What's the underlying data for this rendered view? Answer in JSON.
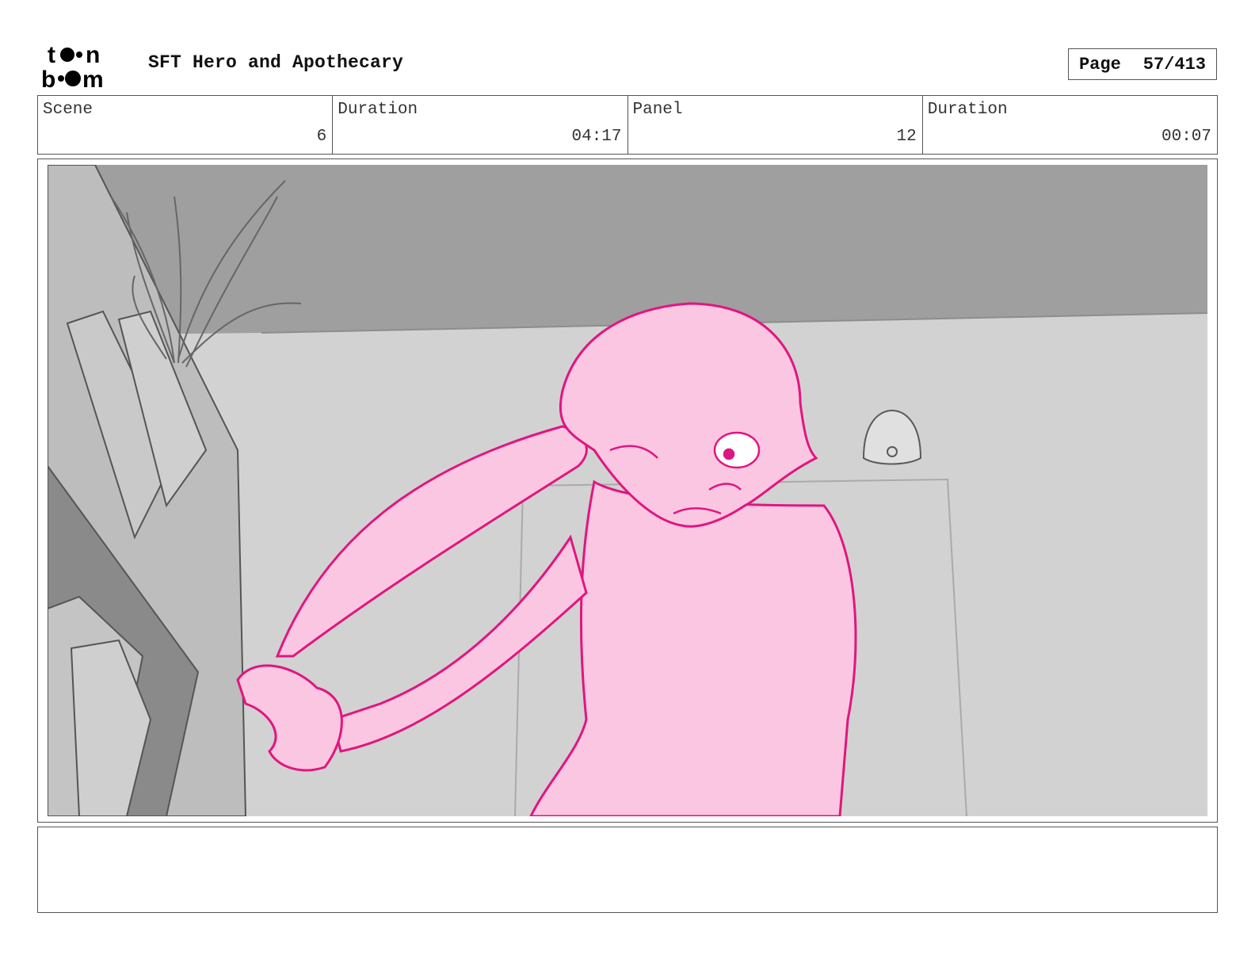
{
  "header": {
    "logo_text": "toonboom",
    "project_title": "SFT Hero and Apothecary",
    "page_label": "Page",
    "page_number": "57/413"
  },
  "info": {
    "scene_label": "Scene",
    "scene_value": "6",
    "scene_duration_label": "Duration",
    "scene_duration_value": "04:17",
    "panel_label": "Panel",
    "panel_value": "12",
    "panel_duration_label": "Duration",
    "panel_duration_value": "00:07"
  },
  "notes": {
    "text": ""
  },
  "colors": {
    "character_fill": "#fbc6e2",
    "character_line": "#e0167f",
    "ceiling": "#9f9f9f",
    "wall": "#d2d2d2",
    "shelf_dark": "#8a8a8a"
  }
}
